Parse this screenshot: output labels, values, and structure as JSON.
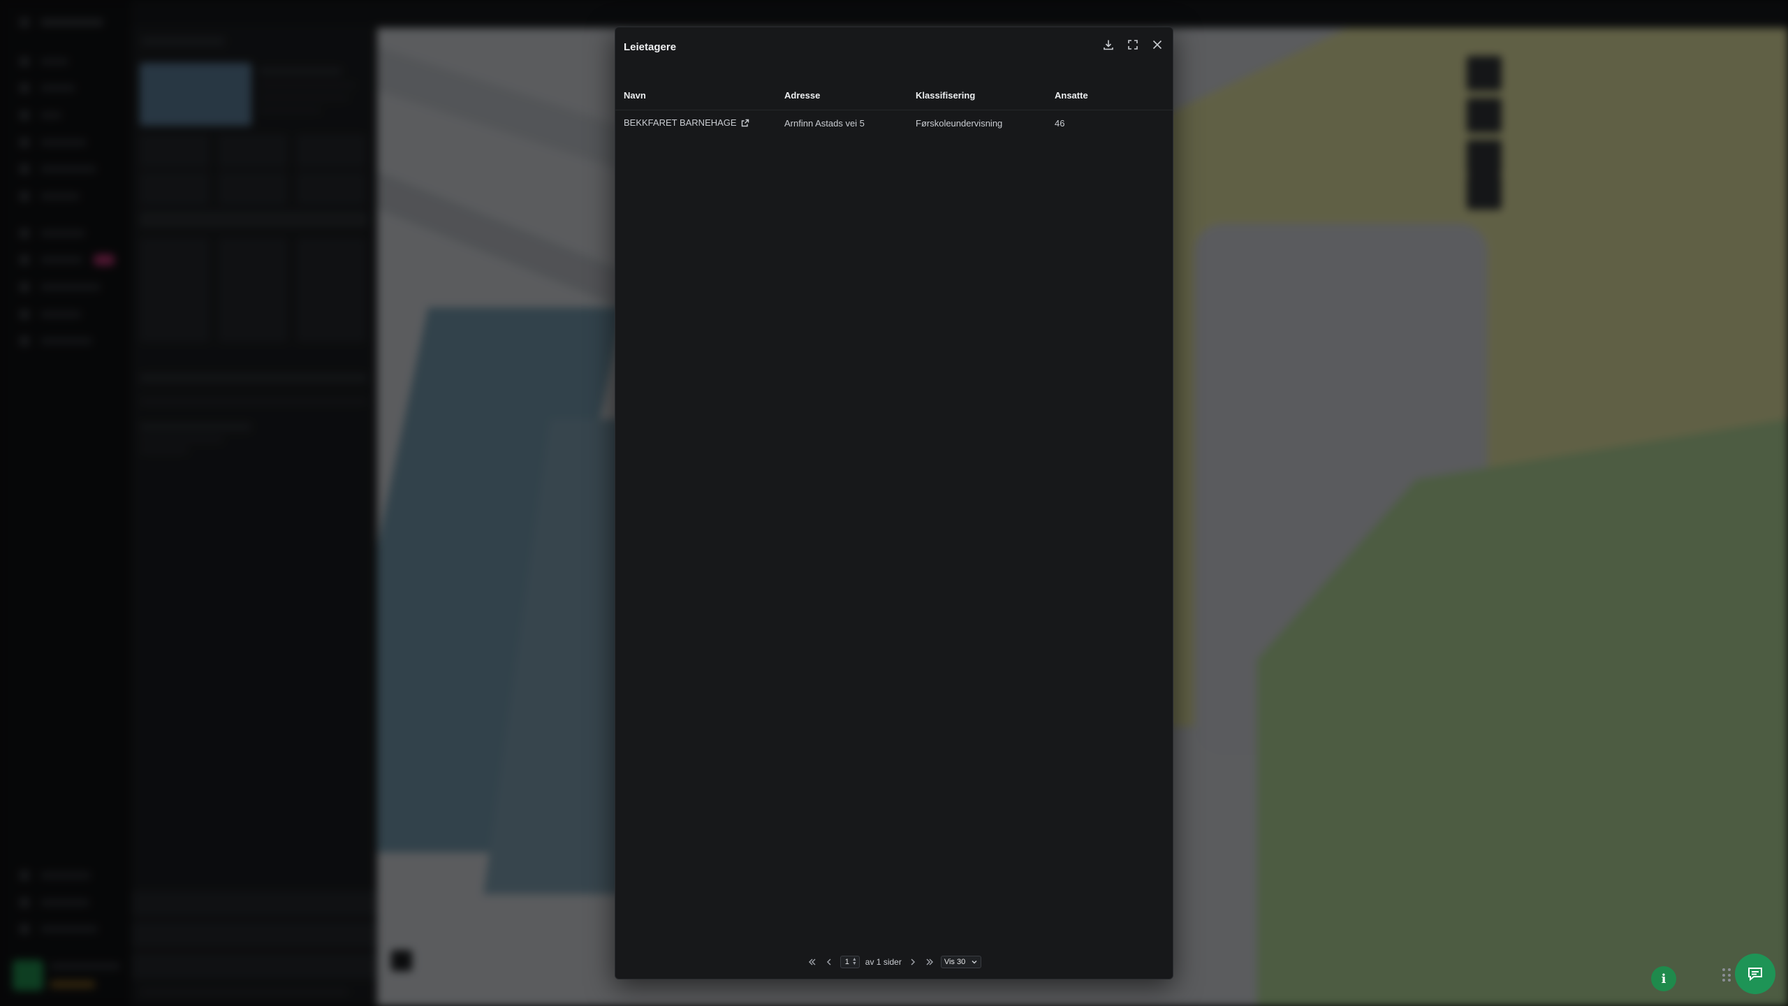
{
  "background": {
    "colors": {
      "map_base": "#c9ccd1",
      "water": "#6f93a6",
      "field": "#d6d59a",
      "green": "#6aa05a"
    }
  },
  "modal": {
    "title": "Leietagere",
    "icons": {
      "download": "download-icon",
      "expand": "expand-icon",
      "close": "close-icon"
    },
    "table": {
      "columns": [
        "Navn",
        "Adresse",
        "Klassifisering",
        "Ansatte"
      ],
      "rows": [
        {
          "name": "BEKKFARET BARNEHAGE",
          "address": "Arnfinn Astads vei 5",
          "classification": "Førskoleundervisning",
          "employees": "46"
        }
      ]
    },
    "pagination": {
      "current_page": "1",
      "of_label": "av 1 sider",
      "page_size": "Vis 30"
    }
  },
  "fab": {
    "info_label": "i"
  },
  "accent": "#1e9456"
}
